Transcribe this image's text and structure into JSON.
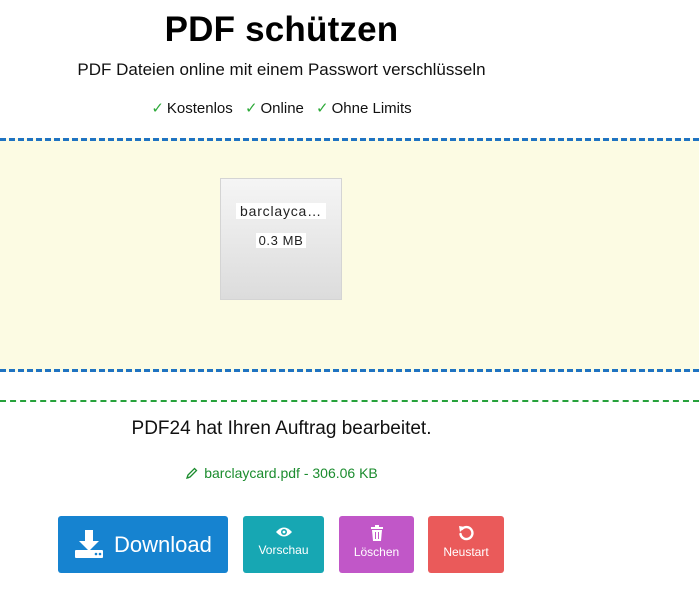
{
  "header": {
    "title": "PDF schützen",
    "subtitle": "PDF Dateien online mit einem Passwort verschlüsseln",
    "features": [
      {
        "check": "✓",
        "label": "Kostenlos"
      },
      {
        "check": "✓",
        "label": "Online"
      },
      {
        "check": "✓",
        "label": "Ohne Limits"
      }
    ]
  },
  "upload": {
    "file_name": "barclayca…",
    "file_size": "0.3 MB"
  },
  "result": {
    "message": "PDF24 hat Ihren Auftrag bearbeitet.",
    "file_link": "barclaycard.pdf - 306.06 KB"
  },
  "buttons": {
    "download": "Download",
    "preview": "Vorschau",
    "delete": "Löschen",
    "restart": "Neustart"
  },
  "colors": {
    "download": "#1683d0",
    "preview": "#17a7b3",
    "delete": "#c157c8",
    "restart": "#ea5a5a",
    "dropzone_bg": "#fcfbe3",
    "success_green": "#1b8c2e"
  },
  "icons": {
    "feature_check": "check-icon",
    "file_link": "pencil-icon",
    "download": "download-icon",
    "preview": "eye-icon",
    "delete": "trash-icon",
    "restart": "restart-icon"
  }
}
